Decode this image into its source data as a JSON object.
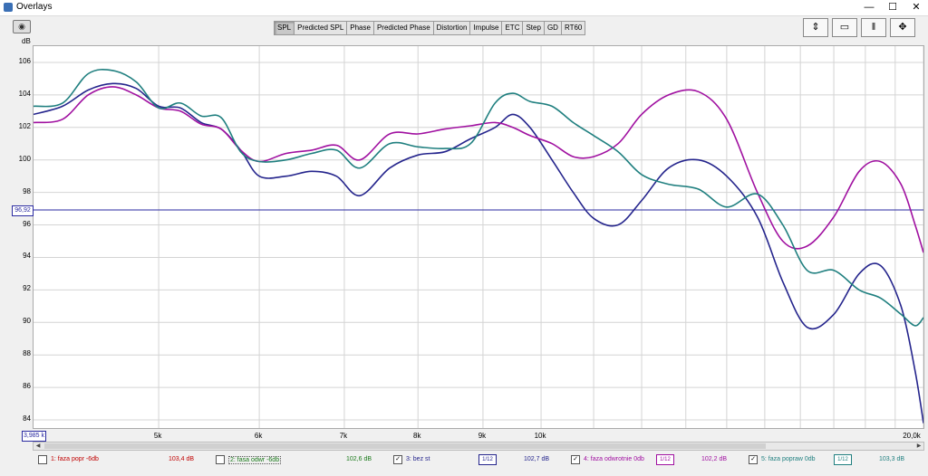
{
  "window": {
    "title": "Overlays",
    "minimize": "—",
    "maximize": "☐",
    "close": "✕"
  },
  "camera_icon": "camera-icon",
  "tabs": [
    {
      "label": "SPL",
      "active": true
    },
    {
      "label": "Predicted SPL",
      "active": false
    },
    {
      "label": "Phase",
      "active": false
    },
    {
      "label": "Predicted Phase",
      "active": false
    },
    {
      "label": "Distortion",
      "active": false
    },
    {
      "label": "Impulse",
      "active": false
    },
    {
      "label": "ETC",
      "active": false
    },
    {
      "label": "Step",
      "active": false
    },
    {
      "label": "GD",
      "active": false
    },
    {
      "label": "RT60",
      "active": false
    }
  ],
  "toolbar_icons": [
    "vertical-fit-icon",
    "display-settings-icon",
    "split-view-icon",
    "fit-all-icon"
  ],
  "y_unit": "dB",
  "y_ticks": [
    "106",
    "104",
    "102",
    "100",
    "98",
    "96",
    "94",
    "92",
    "90",
    "88",
    "86",
    "84"
  ],
  "x_ticks": [
    "5k",
    "6k",
    "7k",
    "8k",
    "9k",
    "10k",
    "20,0k"
  ],
  "cursor_y_label": "96,92",
  "cursor_x_label": "3,985 k",
  "colors": {
    "trace1": "#c00000",
    "trace2": "#1a7a1a",
    "trace3": "#24248c",
    "trace4": "#a010a0",
    "trace5": "#1f7f7f",
    "cursor": "#2a2aa0"
  },
  "legend": [
    {
      "check": "",
      "name": "1: faza popr -6db",
      "value": "103,4 dB",
      "smooth": ""
    },
    {
      "check": "",
      "name": "2: fasa odwr -6db",
      "value": "102,6 dB",
      "smooth": ""
    },
    {
      "check": "✓",
      "name": "3: bez st",
      "value": "102,7 dB",
      "smooth": "1/12"
    },
    {
      "check": "✓",
      "name": "4: faza odwrotnie 0db",
      "value": "102,2 dB",
      "smooth": "1/12"
    },
    {
      "check": "✓",
      "name": "5: faza popraw 0db",
      "value": "103,3 dB",
      "smooth": "1/12"
    }
  ],
  "chart_data": {
    "type": "line",
    "xlabel": "",
    "ylabel": "dB",
    "x_scale": "log",
    "xlim": [
      3985,
      20000
    ],
    "ylim": [
      83.5,
      107
    ],
    "grid": true,
    "cursor_y": 96.92,
    "series": [
      {
        "name": "3: bez st",
        "color": "#24248c",
        "x": [
          3985,
          4200,
          4400,
          4600,
          4800,
          5000,
          5200,
          5400,
          5600,
          5800,
          6000,
          6300,
          6600,
          6900,
          7200,
          7600,
          8000,
          8400,
          8800,
          9200,
          9500,
          9800,
          10200,
          10600,
          11000,
          11500,
          12000,
          12600,
          13300,
          14000,
          14800,
          15500,
          16200,
          17000,
          17800,
          18500,
          19200,
          19700,
          20000
        ],
        "y": [
          102.8,
          103.3,
          104.3,
          104.7,
          104.4,
          103.3,
          103.2,
          102.3,
          101.9,
          100.6,
          99.0,
          99.0,
          99.3,
          99.0,
          97.8,
          99.5,
          100.3,
          100.5,
          101.3,
          102.0,
          102.8,
          102.0,
          100.0,
          98.0,
          96.4,
          96.0,
          97.5,
          99.5,
          100.0,
          99.0,
          96.5,
          92.5,
          89.7,
          90.5,
          93.0,
          93.5,
          91.0,
          87.0,
          83.8
        ]
      },
      {
        "name": "4: faza odwrotnie 0db",
        "color": "#a010a0",
        "x": [
          3985,
          4200,
          4400,
          4600,
          4800,
          5000,
          5200,
          5400,
          5600,
          5800,
          6000,
          6300,
          6600,
          6900,
          7200,
          7600,
          8000,
          8400,
          8800,
          9200,
          9500,
          9800,
          10200,
          10600,
          11000,
          11500,
          12000,
          12600,
          13300,
          14000,
          14800,
          15500,
          16200,
          17000,
          17800,
          18500,
          19200,
          19700,
          20000
        ],
        "y": [
          102.3,
          102.5,
          104.0,
          104.5,
          104.0,
          103.2,
          103.0,
          102.2,
          101.9,
          100.6,
          99.9,
          100.4,
          100.6,
          100.9,
          100.0,
          101.6,
          101.6,
          101.9,
          102.1,
          102.3,
          102.0,
          101.5,
          101.0,
          100.2,
          100.2,
          101.0,
          102.8,
          104.0,
          104.2,
          102.5,
          98.0,
          95.0,
          94.7,
          96.5,
          99.3,
          99.9,
          98.5,
          96.0,
          94.3
        ]
      },
      {
        "name": "5: faza popraw 0db",
        "color": "#1f7f7f",
        "x": [
          3985,
          4200,
          4400,
          4600,
          4800,
          5000,
          5200,
          5400,
          5600,
          5800,
          6000,
          6300,
          6600,
          6900,
          7200,
          7600,
          8000,
          8400,
          8800,
          9200,
          9500,
          9800,
          10200,
          10600,
          11000,
          11500,
          12000,
          12600,
          13300,
          14000,
          14800,
          15500,
          16200,
          17000,
          17800,
          18500,
          19200,
          19700,
          20000
        ],
        "y": [
          103.3,
          103.5,
          105.3,
          105.5,
          104.8,
          103.2,
          103.5,
          102.7,
          102.6,
          100.5,
          99.9,
          100.0,
          100.4,
          100.6,
          99.5,
          101.0,
          100.8,
          100.7,
          101.0,
          103.5,
          104.1,
          103.6,
          103.3,
          102.3,
          101.5,
          100.5,
          99.1,
          98.5,
          98.2,
          97.1,
          97.9,
          96.0,
          93.2,
          93.2,
          92.0,
          91.5,
          90.5,
          89.8,
          90.3
        ]
      }
    ]
  }
}
